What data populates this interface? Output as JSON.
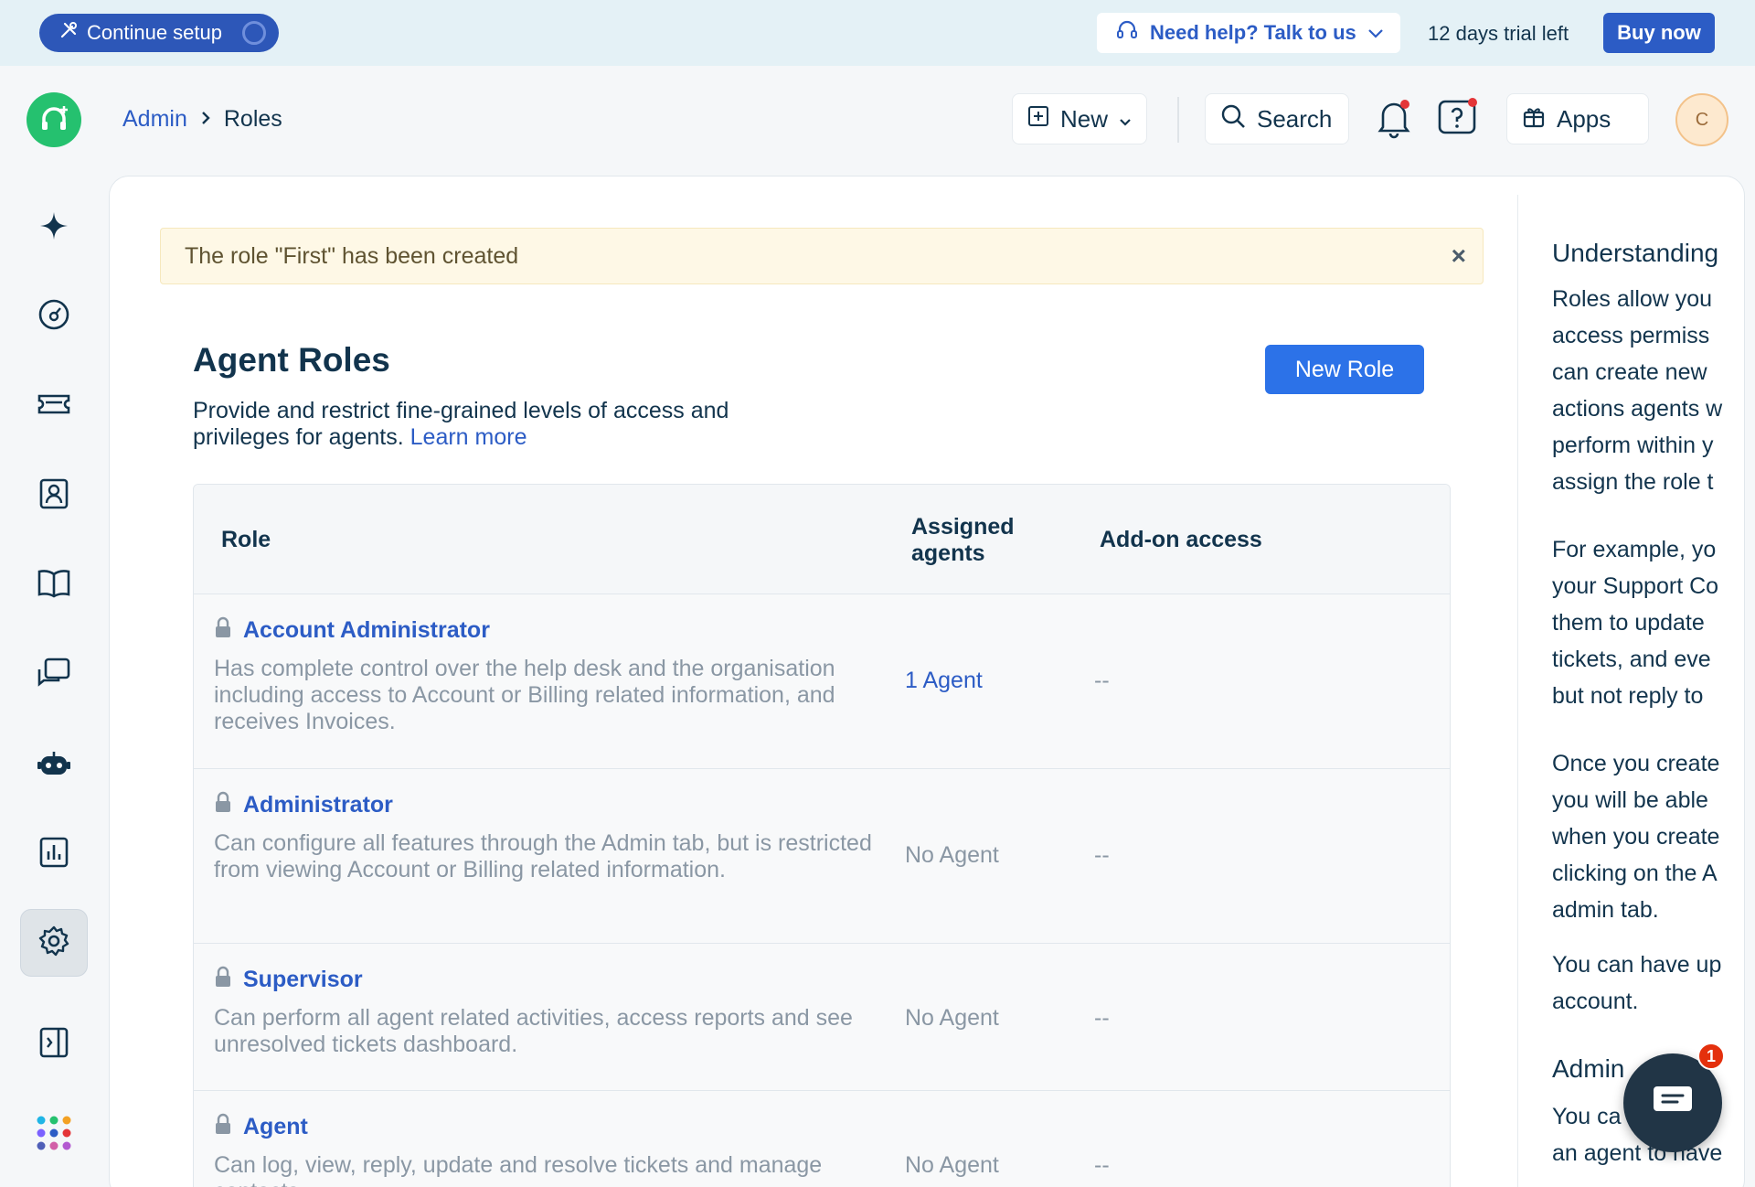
{
  "topbar": {
    "continue_setup": "Continue setup",
    "help": "Need help? Talk to us",
    "trial": "12 days trial left",
    "buy": "Buy now"
  },
  "header": {
    "breadcrumb": [
      "Admin",
      "Roles"
    ],
    "new_label": "New",
    "search_label": "Search",
    "apps_label": "Apps",
    "avatar_initial": "C"
  },
  "alert": {
    "message": "The role \"First\" has been created",
    "close": "×"
  },
  "page": {
    "title": "Agent Roles",
    "description": "Provide and restrict fine-grained levels of access and privileges for agents.",
    "learn_more": "Learn more",
    "new_role": "New Role"
  },
  "table": {
    "headers": {
      "role": "Role",
      "assigned_agents": "Assigned agents",
      "addon": "Add-on access"
    },
    "rows": [
      {
        "name": "Account Administrator",
        "description": "Has complete control over the help desk and the organisation including access to Account or Billing related information, and receives Invoices.",
        "agents": "1 Agent",
        "addon": "--"
      },
      {
        "name": "Administrator",
        "description": "Can configure all features through the Admin tab, but is restricted from viewing Account or Billing related information.",
        "agents": "No Agent",
        "addon": "--"
      },
      {
        "name": "Supervisor",
        "description": "Can perform all agent related activities, access reports and see unresolved tickets dashboard.",
        "agents": "No Agent",
        "addon": "--"
      },
      {
        "name": "Agent",
        "description": "Can log, view, reply, update and resolve tickets and manage contacts.",
        "agents": "No Agent",
        "addon": "--"
      }
    ]
  },
  "right_panel": {
    "title": "Understanding",
    "para1": "Roles allow you\naccess permiss\ncan create new\nactions agents w\nperform within y\nassign the role t",
    "para2": "For example, yo\nyour Support Co\nthem to update\ntickets, and eve\nbut not reply to",
    "para3": "Once you create\nyou will be able\nwhen you create\nclicking on the A\nadmin tab.",
    "para4": "You can have up\naccount.",
    "title2": "Admin",
    "para5": "You ca\nan agent to have"
  },
  "chat": {
    "badge": "1"
  },
  "colors": {
    "primary": "#2c5cc5",
    "button": "#2c72e8",
    "alert_bg": "#fef8e6",
    "brand_green": "#25c16f"
  }
}
